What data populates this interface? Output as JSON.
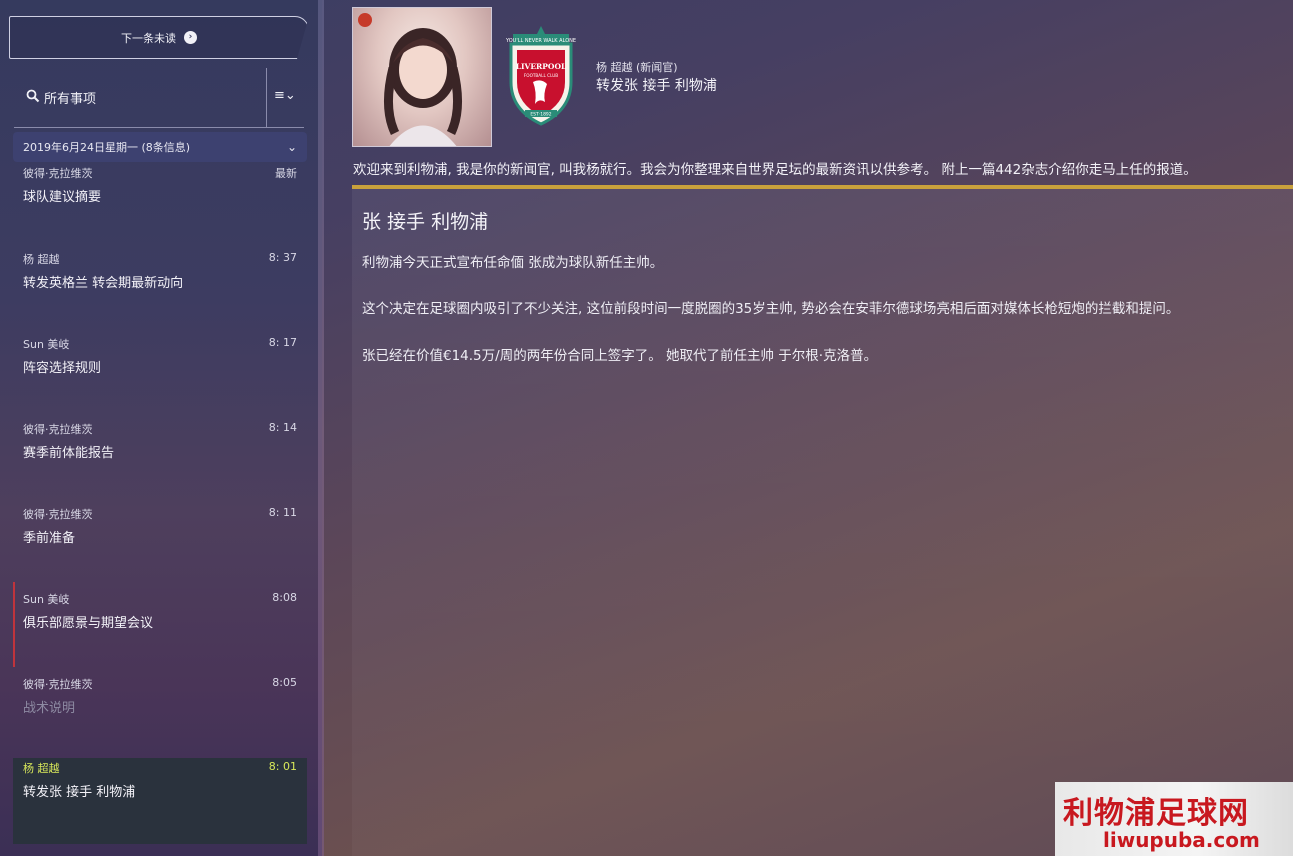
{
  "sidebar": {
    "next_unread_label": "下一条未读",
    "filter_label": "所有事项",
    "date_header": "2019年6月24日星期一 (8条信息)",
    "messages": [
      {
        "from": "彼得·克拉维茨",
        "time": "最新",
        "subject": "球队建议摘要"
      },
      {
        "from": "杨 超越",
        "time": "8: 37",
        "subject": "转发英格兰 转会期最新动向"
      },
      {
        "from": "Sun 美岐",
        "time": "8: 17",
        "subject": "阵容选择规则"
      },
      {
        "from": "彼得·克拉维茨",
        "time": "8: 14",
        "subject": "赛季前体能报告"
      },
      {
        "from": "彼得·克拉维茨",
        "time": "8: 11",
        "subject": "季前准备"
      },
      {
        "from": "Sun 美岐",
        "time": "8:08",
        "subject": "俱乐部愿景与期望会议"
      },
      {
        "from": "彼得·克拉维茨",
        "time": "8:05",
        "subject": "战术说明"
      },
      {
        "from": "杨 超越",
        "time": "8: 01",
        "subject": "转发张 接手 利物浦"
      }
    ]
  },
  "main": {
    "sender": "杨 超越 (新闻官)",
    "header_title": "转发张 接手 利物浦",
    "intro": "欢迎来到利物浦, 我是你的新闻官, 叫我杨就行。我会为你整理来自世界足坛的最新资讯以供参考。 附上一篇442杂志介绍你走马上任的报道。",
    "article_title": "张 接手 利物浦",
    "paragraphs": [
      "利物浦今天正式宣布任命偭 张成为球队新任主帅。",
      "这个决定在足球圈内吸引了不少关注, 这位前段时间一度脱圈的35岁主帅, 势必会在安菲尔德球场亮相后面对媒体长枪短炮的拦截和提问。",
      "张已经在价值€14.5万/周的两年份合同上签字了。 她取代了前任主帅 于尔根·克洛普。"
    ],
    "crest_text": {
      "top": "YOU'LL NEVER WALK ALONE",
      "name": "LIVERPOOL",
      "sub": "FOOTBALL CLUB",
      "est": "EST·1892"
    }
  },
  "watermark": {
    "title": "利物浦足球网",
    "url": "liwupuba.com"
  },
  "colors": {
    "accent_gold": "#c9a13c",
    "selected_time": "#d8e85a",
    "flag_red": "#c0343c"
  }
}
